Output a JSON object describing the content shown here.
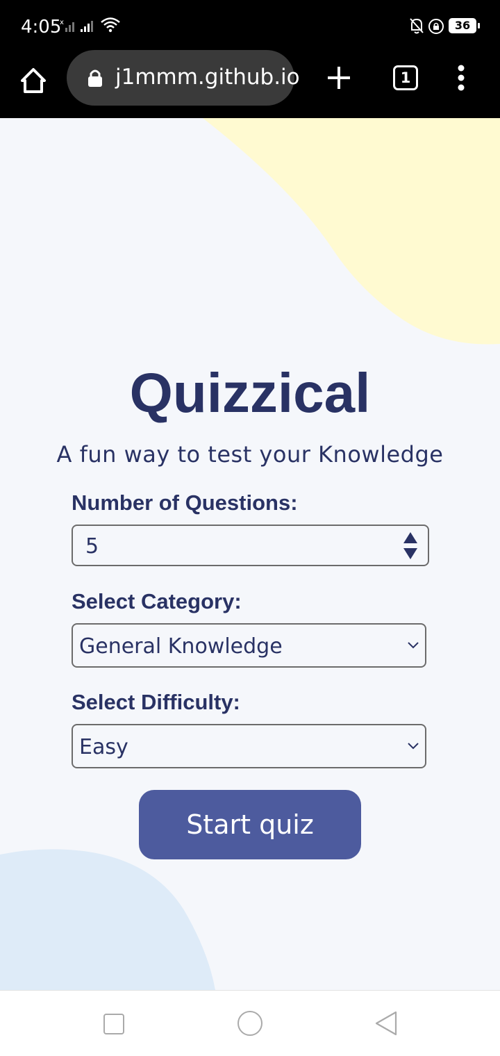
{
  "status_bar": {
    "time": "4:05",
    "battery": "36",
    "icons": [
      "signal-no-service-icon",
      "signal-icon",
      "wifi-icon",
      "bell-muted-icon",
      "rotation-lock-icon",
      "battery-icon"
    ]
  },
  "browser": {
    "url": "j1mmm.github.io",
    "tab_count": "1",
    "icons": [
      "home-icon",
      "lock-icon",
      "plus-icon",
      "tabs-icon",
      "overflow-menu-icon"
    ]
  },
  "page": {
    "title": "Quizzical",
    "subtitle": "A fun way to test your Knowledge",
    "questions_label": "Number of Questions:",
    "questions_value": "5",
    "category_label": "Select Category:",
    "category_value": "General Knowledge",
    "difficulty_label": "Select Difficulty:",
    "difficulty_value": "Easy",
    "start_button": "Start quiz"
  },
  "colors": {
    "primary_text": "#293264",
    "button_bg": "#4D5B9E",
    "background": "#F5F7FB",
    "blob_yellow": "#FFFAD1",
    "blob_blue": "#DEEBF8"
  },
  "navigation": {
    "icons": [
      "recent-apps-icon",
      "home-circle-icon",
      "back-triangle-icon"
    ]
  }
}
